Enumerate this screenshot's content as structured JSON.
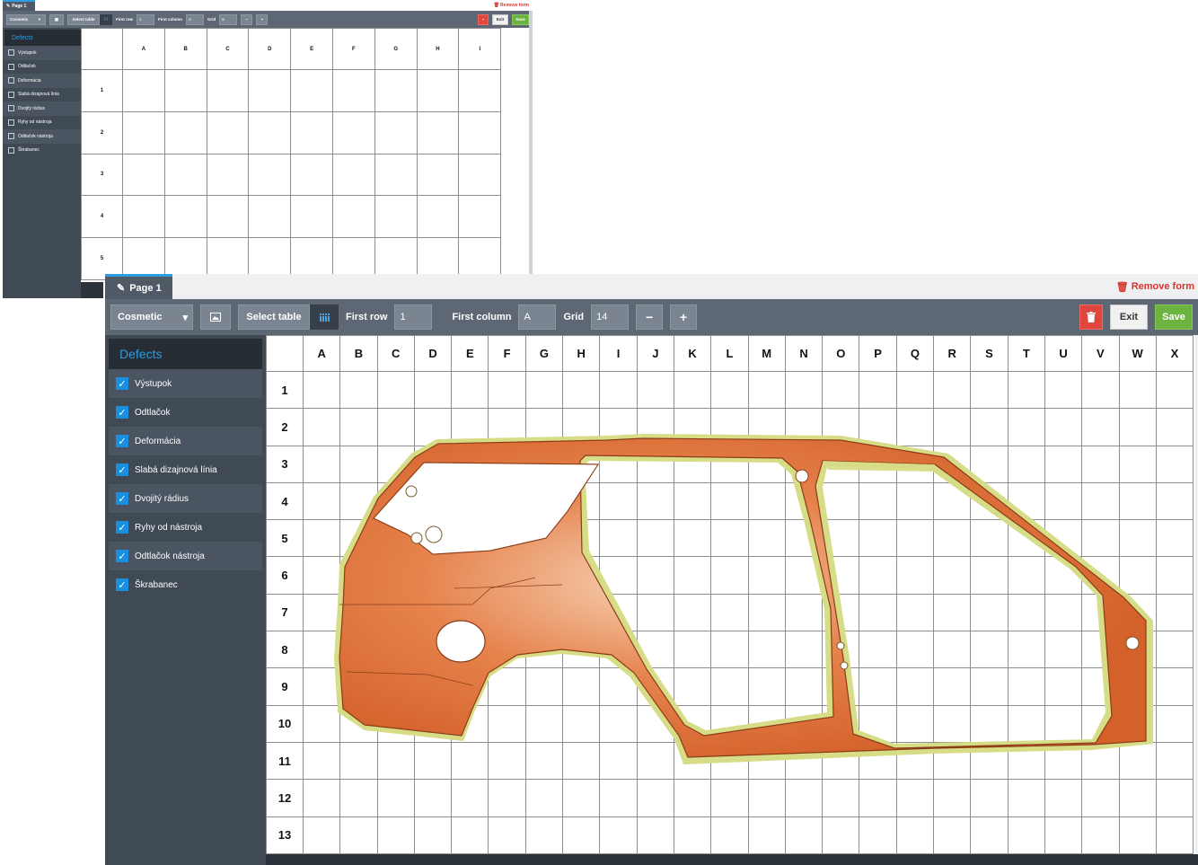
{
  "page_tab": "Page 1",
  "remove_form": "Remove form",
  "toolbar": {
    "form_type": "Cosmetic",
    "select_table": "Select table",
    "first_row_label": "First row",
    "first_row_value": "1",
    "first_column_label": "First column",
    "first_column_value": "A",
    "grid_label": "Grid",
    "grid_value_back": "6",
    "grid_value_front": "14",
    "minus": "−",
    "plus": "+",
    "exit": "Exit",
    "save": "Save"
  },
  "sidebar": {
    "title": "Defects",
    "items": [
      {
        "label": "Výstupok"
      },
      {
        "label": "Odtlačok"
      },
      {
        "label": "Deformácia"
      },
      {
        "label": "Slabá dizajnová línia"
      },
      {
        "label": "Dvojitý rádius"
      },
      {
        "label": "Ryhy od nástroja"
      },
      {
        "label": "Odtlačok nástroja"
      },
      {
        "label": "Škrabanec"
      }
    ]
  },
  "back_grid": {
    "columns": [
      "A",
      "B",
      "C",
      "D",
      "E",
      "F",
      "G",
      "H",
      "I"
    ],
    "rows": [
      "1",
      "2",
      "3",
      "4",
      "5"
    ]
  },
  "front_grid": {
    "columns": [
      "A",
      "B",
      "C",
      "D",
      "E",
      "F",
      "G",
      "H",
      "I",
      "J",
      "K",
      "L",
      "M",
      "N",
      "O",
      "P",
      "Q",
      "R",
      "S",
      "T",
      "U",
      "V",
      "W",
      "X"
    ],
    "rows": [
      "1",
      "2",
      "3",
      "4",
      "5",
      "6",
      "7",
      "8",
      "9",
      "10",
      "11",
      "12",
      "13"
    ]
  },
  "colors": {
    "toolbar": "#5d6874",
    "sidebar": "#404a55",
    "accent": "#2d9de0",
    "save": "#6db33f",
    "delete": "#e0453e",
    "car_body": "#e2703a",
    "car_edge": "#d9dd8a"
  }
}
